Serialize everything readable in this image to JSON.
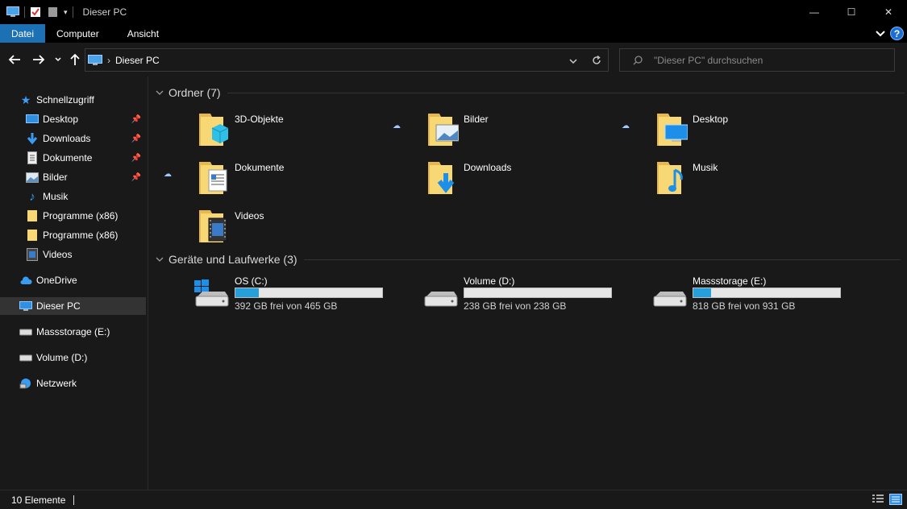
{
  "window": {
    "title": "Dieser PC",
    "minimize_glyph": "—",
    "maximize_glyph": "☐",
    "close_glyph": "✕"
  },
  "ribbon": {
    "tabs": [
      {
        "label": "Datei",
        "active": true
      },
      {
        "label": "Computer",
        "active": false
      },
      {
        "label": "Ansicht",
        "active": false
      }
    ],
    "help_label": "?"
  },
  "address": {
    "path_label": "Dieser PC",
    "separator": "›"
  },
  "search": {
    "placeholder": "\"Dieser PC\" durchsuchen"
  },
  "sidebar": {
    "quick_access": "Schnellzugriff",
    "items": [
      {
        "label": "Desktop",
        "pinned": true,
        "icon": "desktop-icon"
      },
      {
        "label": "Downloads",
        "pinned": true,
        "icon": "download-icon"
      },
      {
        "label": "Dokumente",
        "pinned": true,
        "icon": "document-icon"
      },
      {
        "label": "Bilder",
        "pinned": true,
        "icon": "pictures-icon"
      },
      {
        "label": "Musik",
        "pinned": false,
        "icon": "music-icon"
      },
      {
        "label": "Programme (x86)",
        "pinned": false,
        "icon": "folder-icon"
      },
      {
        "label": "Programme (x86)",
        "pinned": false,
        "icon": "folder-icon"
      },
      {
        "label": "Videos",
        "pinned": false,
        "icon": "video-icon"
      }
    ],
    "onedrive": "OneDrive",
    "this_pc": "Dieser PC",
    "massstorage": "Massstorage (E:)",
    "volume_d": "Volume (D:)",
    "network": "Netzwerk"
  },
  "content": {
    "folders_header": "Ordner (7)",
    "folders": [
      {
        "name": "3D-Objekte",
        "icon": "3d-objects-folder-icon",
        "cloud": false
      },
      {
        "name": "Bilder",
        "icon": "pictures-folder-icon",
        "cloud": true
      },
      {
        "name": "Desktop",
        "icon": "desktop-folder-icon",
        "cloud": true
      },
      {
        "name": "Dokumente",
        "icon": "documents-folder-icon",
        "cloud": true
      },
      {
        "name": "Downloads",
        "icon": "downloads-folder-icon",
        "cloud": false
      },
      {
        "name": "Musik",
        "icon": "music-folder-icon",
        "cloud": false
      },
      {
        "name": "Videos",
        "icon": "videos-folder-icon",
        "cloud": false
      }
    ],
    "drives_header": "Geräte und Laufwerke (3)",
    "drives": [
      {
        "name": "OS (C:)",
        "free": "392 GB frei von 465 GB",
        "used_fraction": 0.157,
        "windows": true
      },
      {
        "name": "Volume (D:)",
        "free": "238 GB frei von 238 GB",
        "used_fraction": 0.0,
        "windows": false
      },
      {
        "name": "Massstorage (E:)",
        "free": "818 GB frei von 931 GB",
        "used_fraction": 0.121,
        "windows": false
      }
    ]
  },
  "status": {
    "count": "10 Elemente"
  },
  "colors": {
    "accent": "#1c70b4",
    "folder": "#f8d775",
    "drive_bar": "#26a0da",
    "background": "#191919"
  }
}
